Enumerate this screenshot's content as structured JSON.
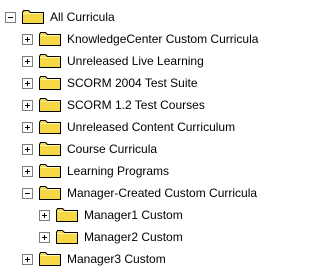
{
  "tree": {
    "root": {
      "label": "All Curricula",
      "expanded": true
    },
    "children": [
      {
        "label": "KnowledgeCenter Custom Curricula",
        "expanded": false
      },
      {
        "label": "Unreleased Live Learning",
        "expanded": false
      },
      {
        "label": "SCORM 2004 Test Suite",
        "expanded": false
      },
      {
        "label": "SCORM 1.2 Test Courses",
        "expanded": false
      },
      {
        "label": "Unreleased Content Curriculum",
        "expanded": false
      },
      {
        "label": "Course Curricula",
        "expanded": false
      },
      {
        "label": "Learning Programs",
        "expanded": false
      },
      {
        "label": "Manager-Created Custom Curricula",
        "expanded": true,
        "children": [
          {
            "label": "Manager1 Custom",
            "expanded": false
          },
          {
            "label": "Manager2 Custom",
            "expanded": false
          }
        ]
      },
      {
        "label": "Manager3 Custom",
        "expanded": false
      }
    ]
  },
  "icons": {
    "expand": "plus-box-icon",
    "collapse": "minus-box-icon",
    "folder": "folder-icon"
  },
  "colors": {
    "folder_fill": "#f6d846",
    "folder_outline": "#000000",
    "toggle_border": "#7f7f7f",
    "text": "#000000",
    "background": "#ffffff"
  }
}
